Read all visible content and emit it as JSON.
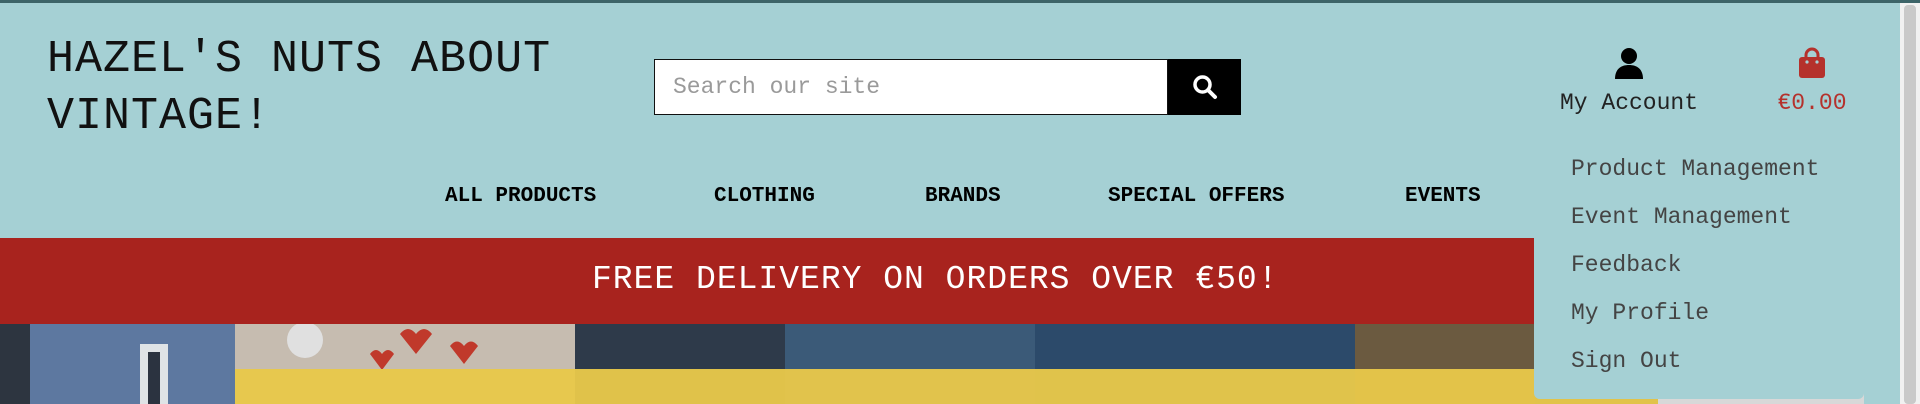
{
  "header": {
    "logo_line1": "HAZEL'S NUTS ABOUT",
    "logo_line2": "VINTAGE!"
  },
  "search": {
    "placeholder": "Search our site",
    "icon": "search-icon"
  },
  "account": {
    "label": "My Account",
    "icon": "user-icon"
  },
  "cart": {
    "total": "€0.00",
    "icon": "shopping-bag-icon"
  },
  "nav": {
    "items": [
      "ALL PRODUCTS",
      "CLOTHING",
      "BRANDS",
      "SPECIAL OFFERS",
      "EVENTS"
    ]
  },
  "banner": {
    "text": "FREE DELIVERY ON ORDERS OVER €50!"
  },
  "account_menu": {
    "items": [
      "Product Management",
      "Event Management",
      "Feedback",
      "My Profile",
      "Sign Out"
    ]
  },
  "colors": {
    "header_bg": "#a5d0d4",
    "banner_bg": "#a8231e",
    "cart_accent": "#b5312c",
    "hero_yellow": "#e8c84a"
  }
}
